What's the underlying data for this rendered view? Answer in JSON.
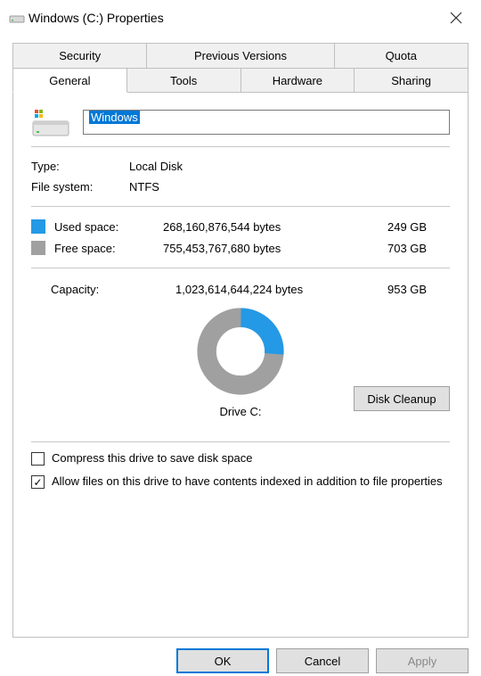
{
  "window": {
    "title": "Windows (C:) Properties"
  },
  "tabs": {
    "row1": [
      "Security",
      "Previous Versions",
      "Quota"
    ],
    "row2": [
      "General",
      "Tools",
      "Hardware",
      "Sharing"
    ],
    "active": "General"
  },
  "drive": {
    "name": "Windows",
    "type_label": "Type:",
    "type_value": "Local Disk",
    "fs_label": "File system:",
    "fs_value": "NTFS"
  },
  "space": {
    "used_label": "Used space:",
    "used_bytes": "268,160,876,544 bytes",
    "used_size": "249 GB",
    "free_label": "Free space:",
    "free_bytes": "755,453,767,680 bytes",
    "free_size": "703 GB",
    "capacity_label": "Capacity:",
    "capacity_bytes": "1,023,614,644,224 bytes",
    "capacity_size": "953 GB"
  },
  "donut": {
    "drive_label": "Drive C:",
    "cleanup_label": "Disk Cleanup"
  },
  "checkboxes": {
    "compress": "Compress this drive to save disk space",
    "index": "Allow files on this drive to have contents indexed in addition to file properties"
  },
  "buttons": {
    "ok": "OK",
    "cancel": "Cancel",
    "apply": "Apply"
  },
  "chart_data": {
    "type": "pie",
    "title": "Drive C:",
    "series": [
      {
        "name": "Used space",
        "value": 268160876544,
        "color": "#2499e5"
      },
      {
        "name": "Free space",
        "value": 755453767680,
        "color": "#a0a0a0"
      }
    ]
  }
}
